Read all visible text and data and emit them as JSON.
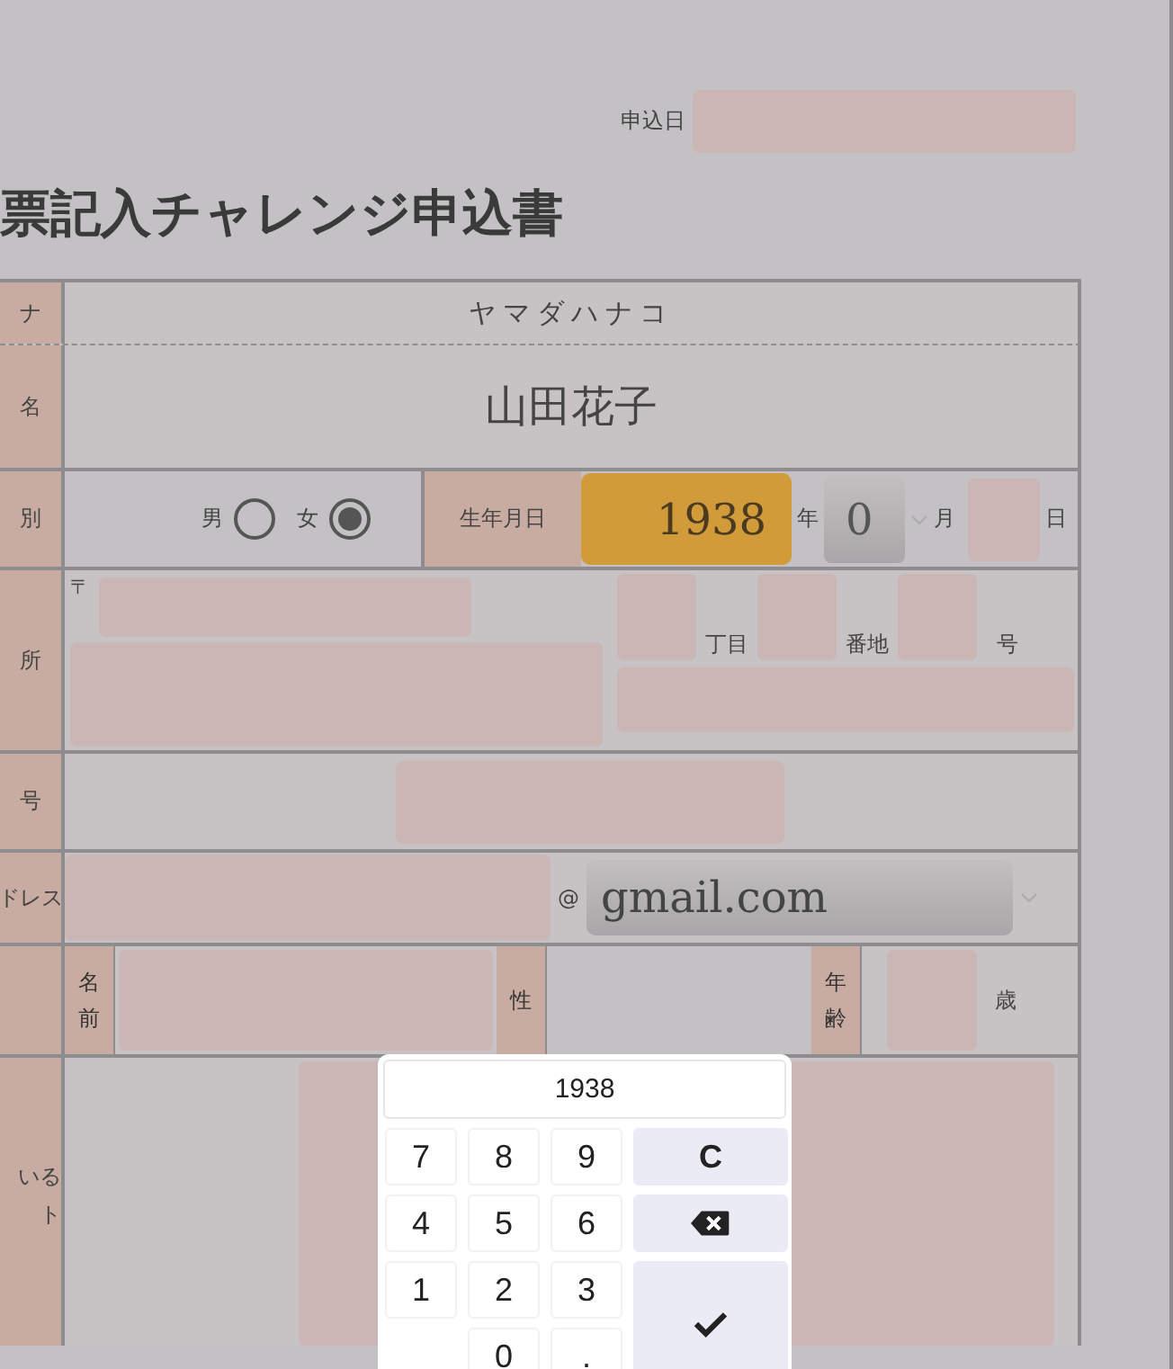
{
  "date_label": "申込日",
  "title": "票記入チャレンジ申込書",
  "furigana": {
    "label": "ナ",
    "value": "ヤマダハナコ"
  },
  "name": {
    "label": "名",
    "value": "山田花子"
  },
  "gender": {
    "label": "別",
    "options": [
      {
        "label": "男",
        "selected": false
      },
      {
        "label": "女",
        "selected": true
      }
    ]
  },
  "birth": {
    "label": "生年月日",
    "year": "1938",
    "year_unit": "年",
    "month": "0",
    "month_unit": "月",
    "day_unit": "日"
  },
  "address": {
    "label": "所",
    "postal_mark": "〒",
    "units": [
      "丁目",
      "番地",
      "号"
    ]
  },
  "phone": {
    "label": "号"
  },
  "email": {
    "label": "ドレス",
    "at": "@",
    "domain": "gmail.com"
  },
  "child": {
    "name_label": "名前",
    "gender_label": "性",
    "age_label": "年齢",
    "age_unit": "歳"
  },
  "last_row": {
    "label_lines": [
      "いる",
      "ト"
    ]
  },
  "keypad": {
    "display": "1938",
    "keys": [
      {
        "kind": "digit",
        "label": "7"
      },
      {
        "kind": "digit",
        "label": "8"
      },
      {
        "kind": "digit",
        "label": "9"
      },
      {
        "kind": "clear",
        "label": "C"
      },
      {
        "kind": "digit",
        "label": "4"
      },
      {
        "kind": "digit",
        "label": "5"
      },
      {
        "kind": "digit",
        "label": "6"
      },
      {
        "kind": "backspace"
      },
      {
        "kind": "digit",
        "label": "1"
      },
      {
        "kind": "digit",
        "label": "2"
      },
      {
        "kind": "digit",
        "label": "3"
      },
      {
        "kind": "enter"
      },
      {
        "kind": "zero",
        "label": "0"
      },
      {
        "kind": "digit",
        "label": "."
      }
    ]
  }
}
